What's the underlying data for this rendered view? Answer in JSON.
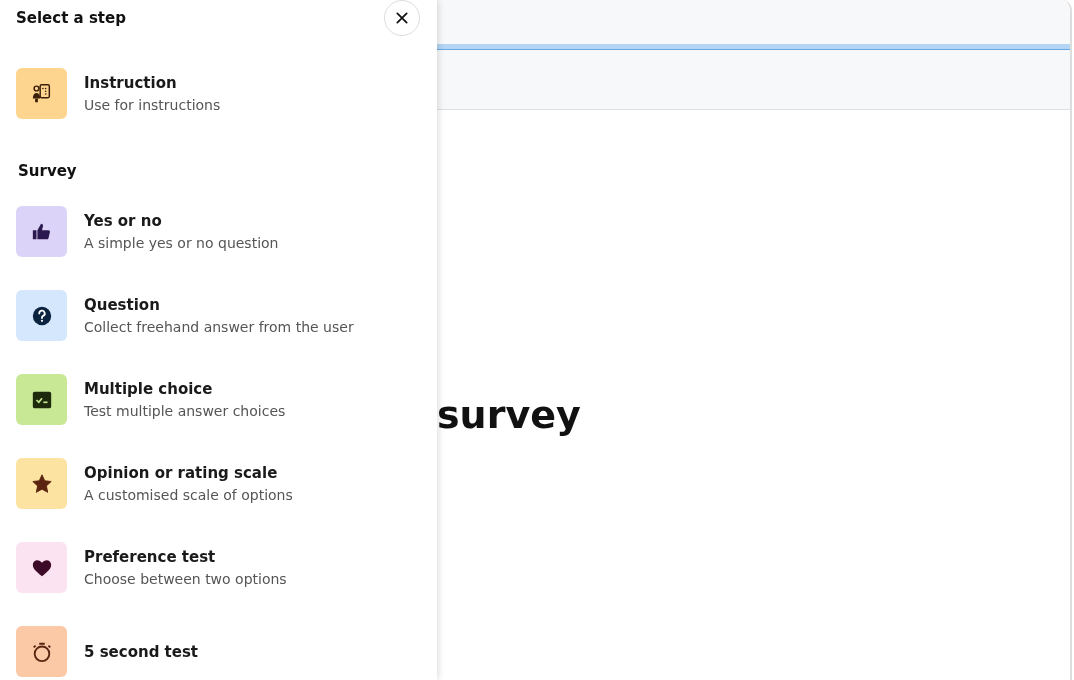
{
  "panel": {
    "title": "Select a step",
    "groups": [
      {
        "items": [
          {
            "kind": "instruction",
            "title": "Instruction",
            "description": "Use for instructions",
            "color": "#fdd58e"
          }
        ]
      },
      {
        "heading": "Survey",
        "items": [
          {
            "kind": "thumb",
            "title": "Yes or no",
            "description": "A simple yes or no question",
            "color": "#dcd3f8"
          },
          {
            "kind": "question",
            "title": "Question",
            "description": "Collect freehand answer from the user",
            "color": "#d4e7fc"
          },
          {
            "kind": "checklist",
            "title": "Multiple choice",
            "description": "Test multiple answer choices",
            "color": "#c9e896"
          },
          {
            "kind": "star",
            "title": "Opinion or rating scale",
            "description": "A customised scale of options",
            "color": "#fde3a2"
          },
          {
            "kind": "heart",
            "title": "Preference test",
            "description": "Choose between two options",
            "color": "#fbe3f1"
          },
          {
            "kind": "timer",
            "title": "5 second test",
            "color": "#fcc9a6"
          }
        ]
      }
    ]
  },
  "main": {
    "heading": "survey"
  }
}
